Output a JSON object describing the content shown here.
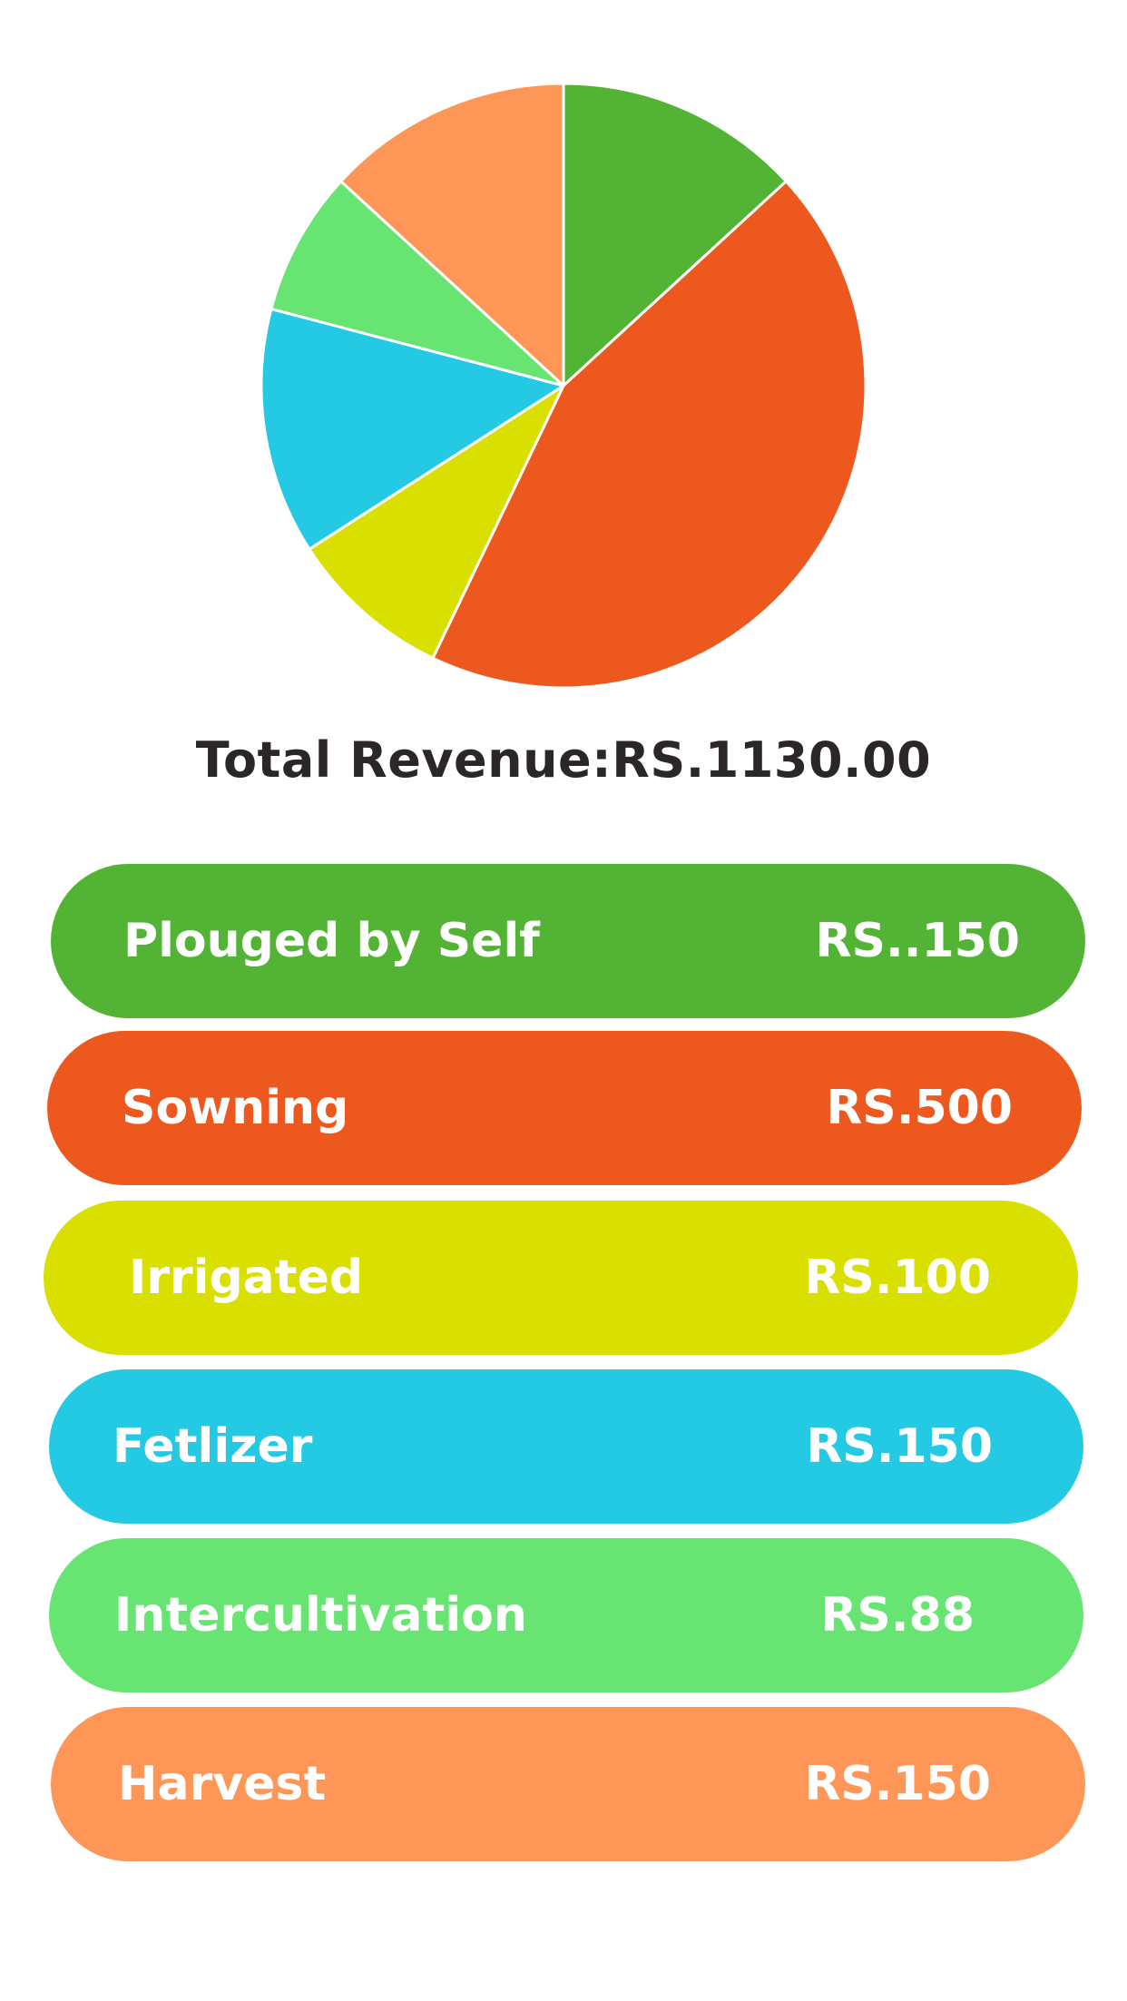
{
  "chart_data": {
    "type": "pie",
    "categories": [
      "Plouged by Self",
      "Sowning",
      "Irrigated",
      "Fetlizer",
      "Intercultivation",
      "Harvest"
    ],
    "values": [
      150,
      500,
      100,
      150,
      88,
      150
    ],
    "colors": [
      "#52b334",
      "#ec581e",
      "#d9e000",
      "#24c9e4",
      "#67e472",
      "#fe9658"
    ],
    "start": "12 o'clock",
    "direction": "clockwise"
  },
  "total": {
    "text": "Total Revenue:RS.1130.00"
  },
  "rows": [
    {
      "label": "Plouged by Self",
      "value": "RS..150",
      "color": "#52b334"
    },
    {
      "label": "Sowning",
      "value": "RS.500",
      "color": "#ec581e"
    },
    {
      "label": "Irrigated",
      "value": "RS.100",
      "color": "#d9e000"
    },
    {
      "label": "Fetlizer",
      "value": "RS.150",
      "color": "#24c9e4"
    },
    {
      "label": "Intercultivation",
      "value": "RS.88",
      "color": "#67e472"
    },
    {
      "label": "Harvest",
      "value": "RS.150",
      "color": "#fe9658"
    }
  ]
}
